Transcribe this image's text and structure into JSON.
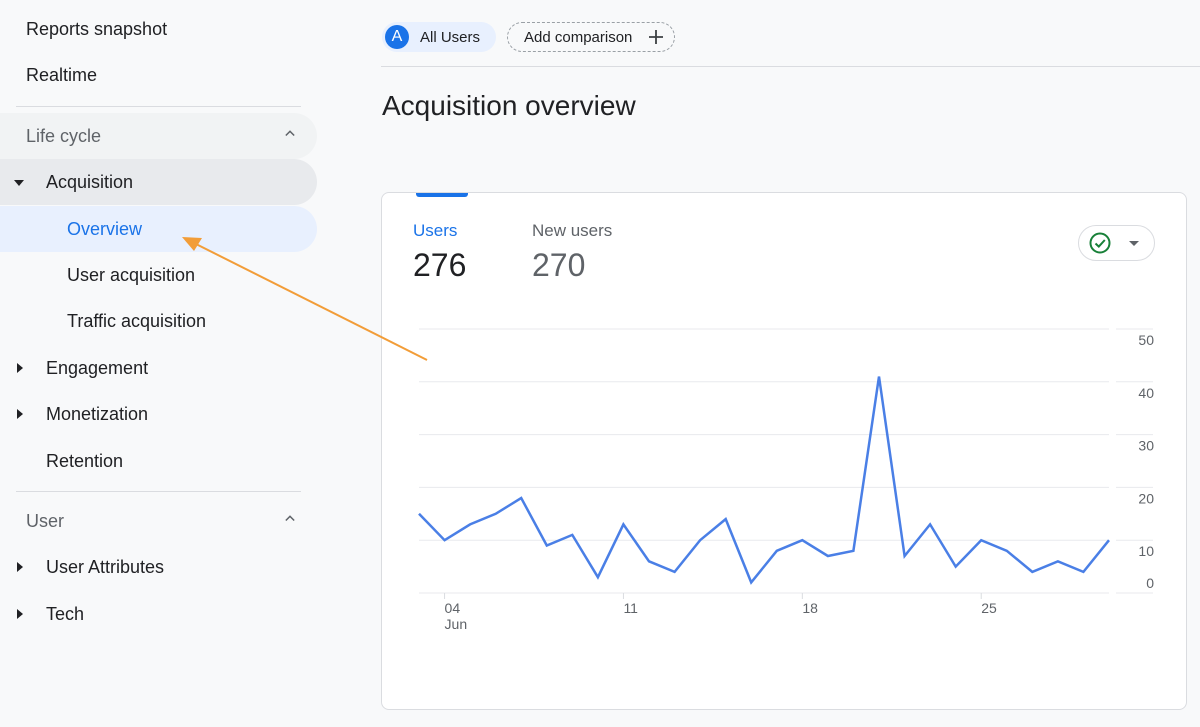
{
  "sidebar": {
    "top_items": [
      "Reports snapshot",
      "Realtime"
    ],
    "sections": [
      {
        "label": "Life cycle",
        "expanded": true
      },
      {
        "label": "User",
        "expanded": true
      }
    ],
    "lifecycle": {
      "acquisition": {
        "label": "Acquisition",
        "children": [
          "Overview",
          "User acquisition",
          "Traffic acquisition"
        ],
        "active_child": "Overview"
      },
      "engagement": "Engagement",
      "monetization": "Monetization",
      "retention": "Retention"
    },
    "user": {
      "user_attributes": "User Attributes",
      "tech": "Tech"
    }
  },
  "header": {
    "segment_avatar": "A",
    "segment_label": "All Users",
    "add_comparison_label": "Add comparison"
  },
  "page_title": "Acquisition overview",
  "card": {
    "metrics": [
      {
        "name": "Users",
        "value": "276",
        "selected": true
      },
      {
        "name": "New users",
        "value": "270",
        "selected": false
      }
    ]
  },
  "colors": {
    "accent": "#1a73e8",
    "line": "#4a7fe6",
    "annotation_arrow": "#f29d38",
    "status_ok": "#188038"
  },
  "chart_data": {
    "type": "line",
    "title": "",
    "xlabel": "",
    "ylabel": "",
    "series": [
      {
        "name": "Users",
        "x": [
          "Jun 03",
          "Jun 04",
          "Jun 05",
          "Jun 06",
          "Jun 07",
          "Jun 08",
          "Jun 09",
          "Jun 10",
          "Jun 11",
          "Jun 12",
          "Jun 13",
          "Jun 14",
          "Jun 15",
          "Jun 16",
          "Jun 17",
          "Jun 18",
          "Jun 19",
          "Jun 20",
          "Jun 21",
          "Jun 22",
          "Jun 23",
          "Jun 24",
          "Jun 25",
          "Jun 26",
          "Jun 27",
          "Jun 28",
          "Jun 29",
          "Jun 30"
        ],
        "values": [
          15,
          10,
          13,
          15,
          18,
          9,
          11,
          3,
          13,
          6,
          4,
          10,
          14,
          2,
          8,
          10,
          7,
          8,
          41,
          7,
          13,
          5,
          10,
          8,
          4,
          6,
          4,
          10
        ]
      }
    ],
    "x_ticks": [
      {
        "index": 1,
        "label": "04",
        "sublabel": "Jun"
      },
      {
        "index": 8,
        "label": "11",
        "sublabel": ""
      },
      {
        "index": 15,
        "label": "18",
        "sublabel": ""
      },
      {
        "index": 22,
        "label": "25",
        "sublabel": ""
      }
    ],
    "y_ticks": [
      0,
      10,
      20,
      30,
      40,
      50
    ],
    "ylim": [
      0,
      50
    ],
    "grid": true,
    "y_axis_side": "right",
    "legend": "none"
  }
}
